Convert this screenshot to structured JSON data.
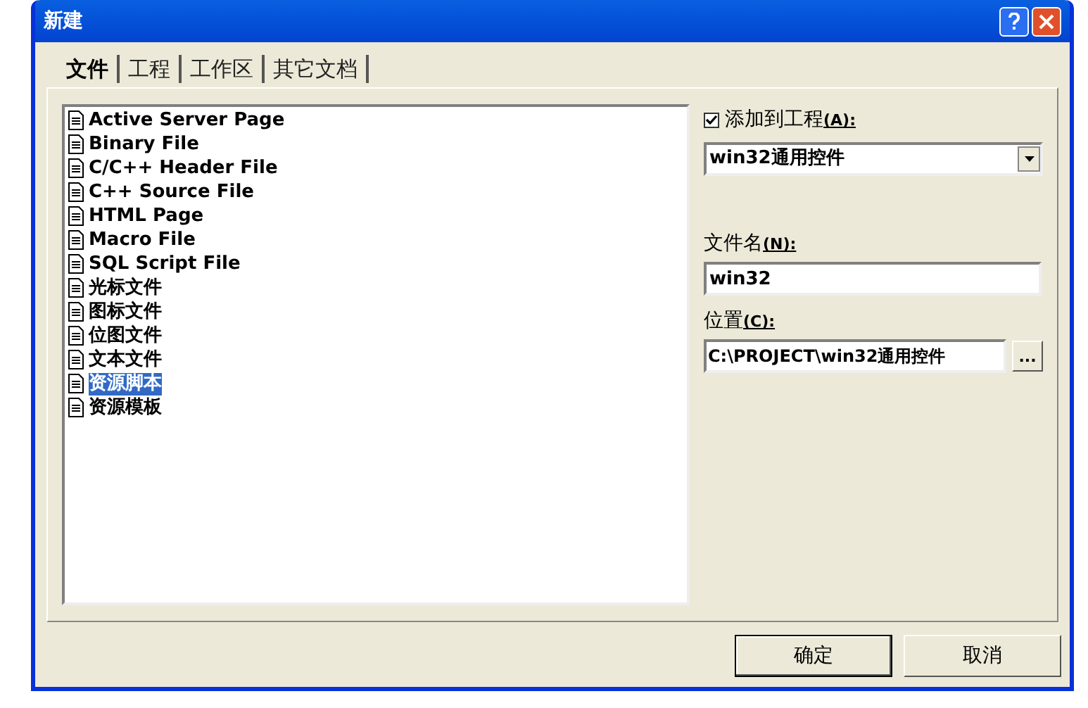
{
  "window": {
    "title": "新建"
  },
  "tabs": [
    {
      "label": "文件",
      "selected": true
    },
    {
      "label": "工程",
      "selected": false
    },
    {
      "label": "工作区",
      "selected": false
    },
    {
      "label": "其它文档",
      "selected": false
    }
  ],
  "file_types": [
    {
      "label": "Active Server Page",
      "selected": false
    },
    {
      "label": "Binary File",
      "selected": false
    },
    {
      "label": "C/C++ Header File",
      "selected": false
    },
    {
      "label": "C++ Source File",
      "selected": false
    },
    {
      "label": "HTML Page",
      "selected": false
    },
    {
      "label": "Macro File",
      "selected": false
    },
    {
      "label": "SQL Script File",
      "selected": false
    },
    {
      "label": "光标文件",
      "selected": false
    },
    {
      "label": "图标文件",
      "selected": false
    },
    {
      "label": "位图文件",
      "selected": false
    },
    {
      "label": "文本文件",
      "selected": false
    },
    {
      "label": "资源脚本",
      "selected": true
    },
    {
      "label": "资源模板",
      "selected": false
    }
  ],
  "add_to_project": {
    "label": "添加到工程",
    "hotkey": "(A):",
    "checked": true
  },
  "project": {
    "value": "win32通用控件"
  },
  "file_name": {
    "label": "文件名",
    "hotkey": "(N):",
    "value": "win32"
  },
  "location": {
    "label": "位置",
    "hotkey": "(C):",
    "value": "C:\\PROJECT\\win32通用控件",
    "browse": "..."
  },
  "buttons": [
    "确定",
    "取消"
  ]
}
